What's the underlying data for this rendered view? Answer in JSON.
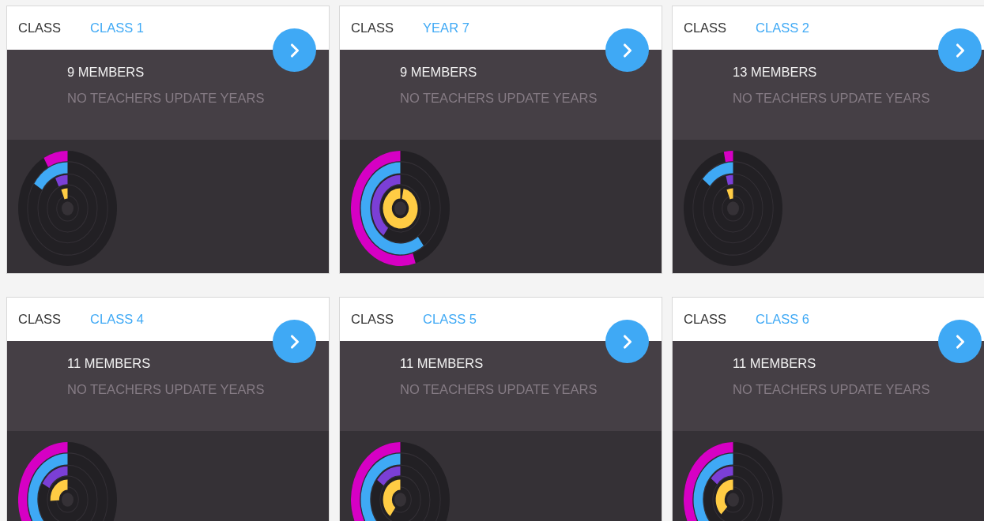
{
  "cards": [
    {
      "label": "CLASS",
      "name": "CLASS 1",
      "members": "9 MEMBERS",
      "note": "NO TEACHERS UPDATE YEARS"
    },
    {
      "label": "CLASS",
      "name": "YEAR 7",
      "members": "9 MEMBERS",
      "note": "NO TEACHERS UPDATE YEARS"
    },
    {
      "label": "CLASS",
      "name": "CLASS 2",
      "members": "13 MEMBERS",
      "note": "NO TEACHERS UPDATE YEARS"
    },
    {
      "label": "CLASS",
      "name": "CLASS 4",
      "members": "11 MEMBERS",
      "note": "NO TEACHERS UPDATE YEARS"
    },
    {
      "label": "CLASS",
      "name": "CLASS 5",
      "members": "11 MEMBERS",
      "note": "NO TEACHERS UPDATE YEARS"
    },
    {
      "label": "CLASS",
      "name": "CLASS 6",
      "members": "11 MEMBERS",
      "note": "NO TEACHERS UPDATE YEARS"
    }
  ]
}
